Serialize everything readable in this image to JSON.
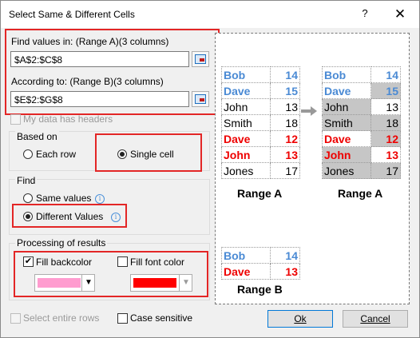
{
  "title": "Select Same & Different Cells",
  "titlebar": {
    "help": "?",
    "close": "✕"
  },
  "find_in": {
    "label": "Find values in: (Range A)(3 columns)",
    "value": "$A$2:$C$8"
  },
  "according": {
    "label": "According to: (Range B)(3 columns)",
    "value": "$E$2:$G$8"
  },
  "headers": {
    "label": "My data has headers",
    "checked": false
  },
  "based_on": {
    "label": "Based on",
    "each_row": "Each row",
    "single_cell": "Single cell",
    "selected": "single_cell"
  },
  "find": {
    "label": "Find",
    "same": "Same values",
    "different": "Different Values",
    "selected": "different"
  },
  "processing": {
    "label": "Processing of results",
    "fill_back": {
      "label": "Fill backcolor",
      "checked": true,
      "color": "#ff9ccf"
    },
    "fill_font": {
      "label": "Fill font color",
      "checked": false,
      "color": "#ff0000"
    }
  },
  "select_rows": {
    "label": "Select entire rows",
    "checked": false
  },
  "case_sensitive": {
    "label": "Case sensitive",
    "checked": false
  },
  "buttons": {
    "ok": "Ok",
    "cancel": "Cancel"
  },
  "preview": {
    "range_a": [
      [
        "Bob",
        "14"
      ],
      [
        "Dave",
        "15"
      ],
      [
        "John",
        "13"
      ],
      [
        "Smith",
        "18"
      ],
      [
        "Dave",
        "12"
      ],
      [
        "John",
        "13"
      ],
      [
        "Jones",
        "17"
      ]
    ],
    "range_b": [
      [
        "Bob",
        "14"
      ],
      [
        "Dave",
        "13"
      ]
    ],
    "range_a_label": "Range A",
    "range_a2_label": "Range A",
    "range_b_label": "Range B"
  }
}
